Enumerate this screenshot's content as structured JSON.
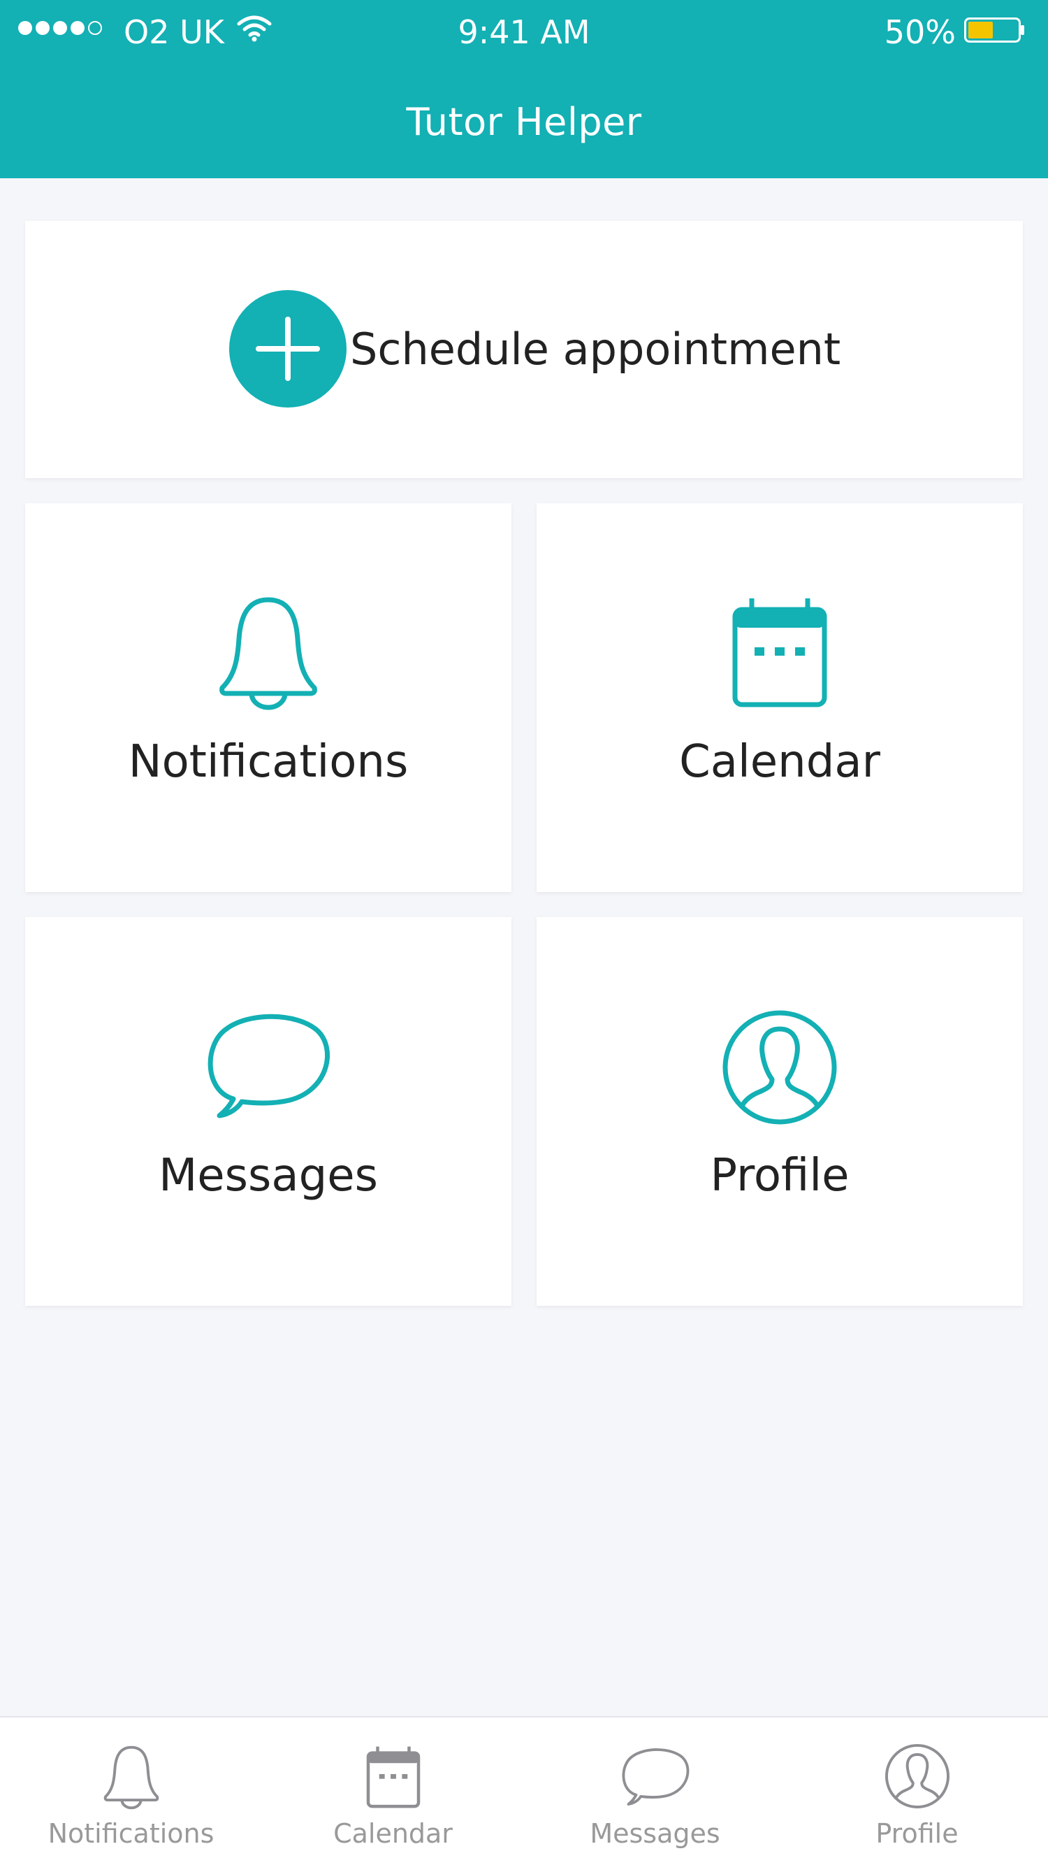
{
  "status_bar": {
    "carrier": "O2 UK",
    "time": "9:41 AM",
    "battery_percent": "50%",
    "battery_level": 0.5,
    "signal_strength": 4
  },
  "app": {
    "title": "Tutor Helper",
    "accent_color": "#13b0b4",
    "battery_color": "#f5c400"
  },
  "schedule_card": {
    "label": "Schedule appointment",
    "icon": "plus-circle-icon"
  },
  "tiles": [
    {
      "label": "Notifications",
      "icon": "bell-icon"
    },
    {
      "label": "Calendar",
      "icon": "calendar-icon"
    },
    {
      "label": "Messages",
      "icon": "speech-bubble-icon"
    },
    {
      "label": "Profile",
      "icon": "user-circle-icon"
    }
  ],
  "tab_bar": {
    "items": [
      {
        "label": "Notifications",
        "icon": "bell-icon"
      },
      {
        "label": "Calendar",
        "icon": "calendar-icon"
      },
      {
        "label": "Messages",
        "icon": "speech-bubble-icon"
      },
      {
        "label": "Profile",
        "icon": "user-circle-icon"
      }
    ]
  }
}
